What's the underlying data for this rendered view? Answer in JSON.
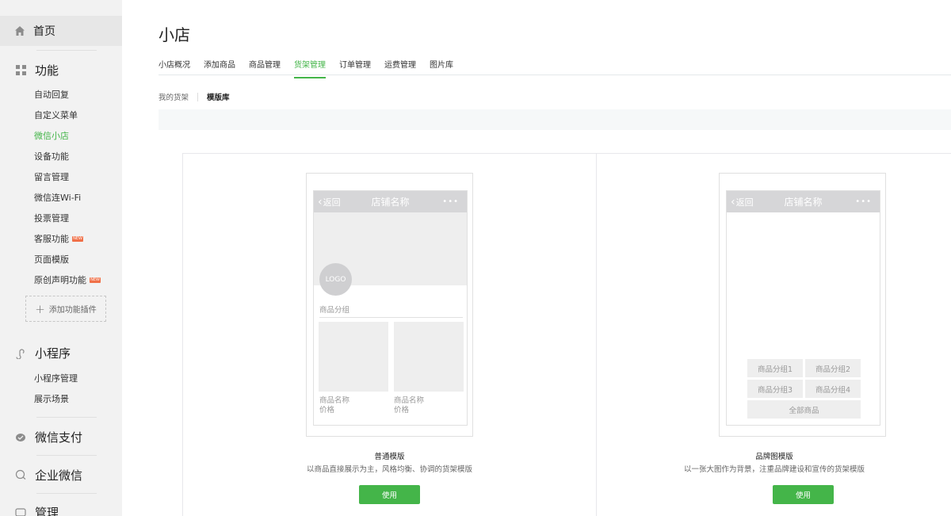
{
  "sidebar": {
    "home": {
      "label": "首页",
      "icon": "home-icon"
    },
    "function": {
      "label": "功能",
      "icon": "grid-icon",
      "items": [
        {
          "label": "自动回复"
        },
        {
          "label": "自定义菜单"
        },
        {
          "label": "微信小店",
          "active": true
        },
        {
          "label": "设备功能"
        },
        {
          "label": "留言管理"
        },
        {
          "label": "微信连Wi-Fi"
        },
        {
          "label": "投票管理"
        },
        {
          "label": "客服功能",
          "badge": "NEW"
        },
        {
          "label": "页面模版"
        },
        {
          "label": "原创声明功能",
          "badge": "NEW"
        }
      ],
      "add_plugin": "添加功能插件"
    },
    "miniprogram": {
      "label": "小程序",
      "icon": "link-icon",
      "items": [
        {
          "label": "小程序管理"
        },
        {
          "label": "展示场景"
        }
      ]
    },
    "pay": {
      "label": "微信支付",
      "icon": "pay-icon"
    },
    "enterprise": {
      "label": "企业微信",
      "icon": "chat-icon"
    },
    "manage": {
      "label": "管理",
      "icon": "manage-icon"
    }
  },
  "main": {
    "title": "小店",
    "tabs": [
      {
        "label": "小店概况"
      },
      {
        "label": "添加商品"
      },
      {
        "label": "商品管理"
      },
      {
        "label": "货架管理",
        "active": true
      },
      {
        "label": "订单管理"
      },
      {
        "label": "运费管理"
      },
      {
        "label": "图片库"
      }
    ],
    "subtabs": [
      {
        "label": "我的货架"
      },
      {
        "label": "模版库",
        "active": true
      }
    ]
  },
  "templates": [
    {
      "phone": {
        "back": "返回",
        "shop_name": "店铺名称",
        "more": "•••",
        "logo": "LOGO",
        "group": "商品分组",
        "products": [
          {
            "name": "商品名称",
            "price": "价格"
          },
          {
            "name": "商品名称",
            "price": "价格"
          }
        ]
      },
      "title": "普通模版",
      "desc": "以商品直接展示为主，风格均衡、协调的货架模版",
      "button": "使用"
    },
    {
      "phone": {
        "back": "返回",
        "shop_name": "店铺名称",
        "more": "•••",
        "groups": [
          "商品分组1",
          "商品分组2",
          "商品分组3",
          "商品分组4"
        ],
        "all": "全部商品"
      },
      "title": "品牌图模版",
      "desc": "以一张大图作为背景，注重品牌建设和宣传的货架模版",
      "button": "使用"
    }
  ],
  "colors": {
    "accent": "#44b549",
    "badge": "#f07048"
  }
}
